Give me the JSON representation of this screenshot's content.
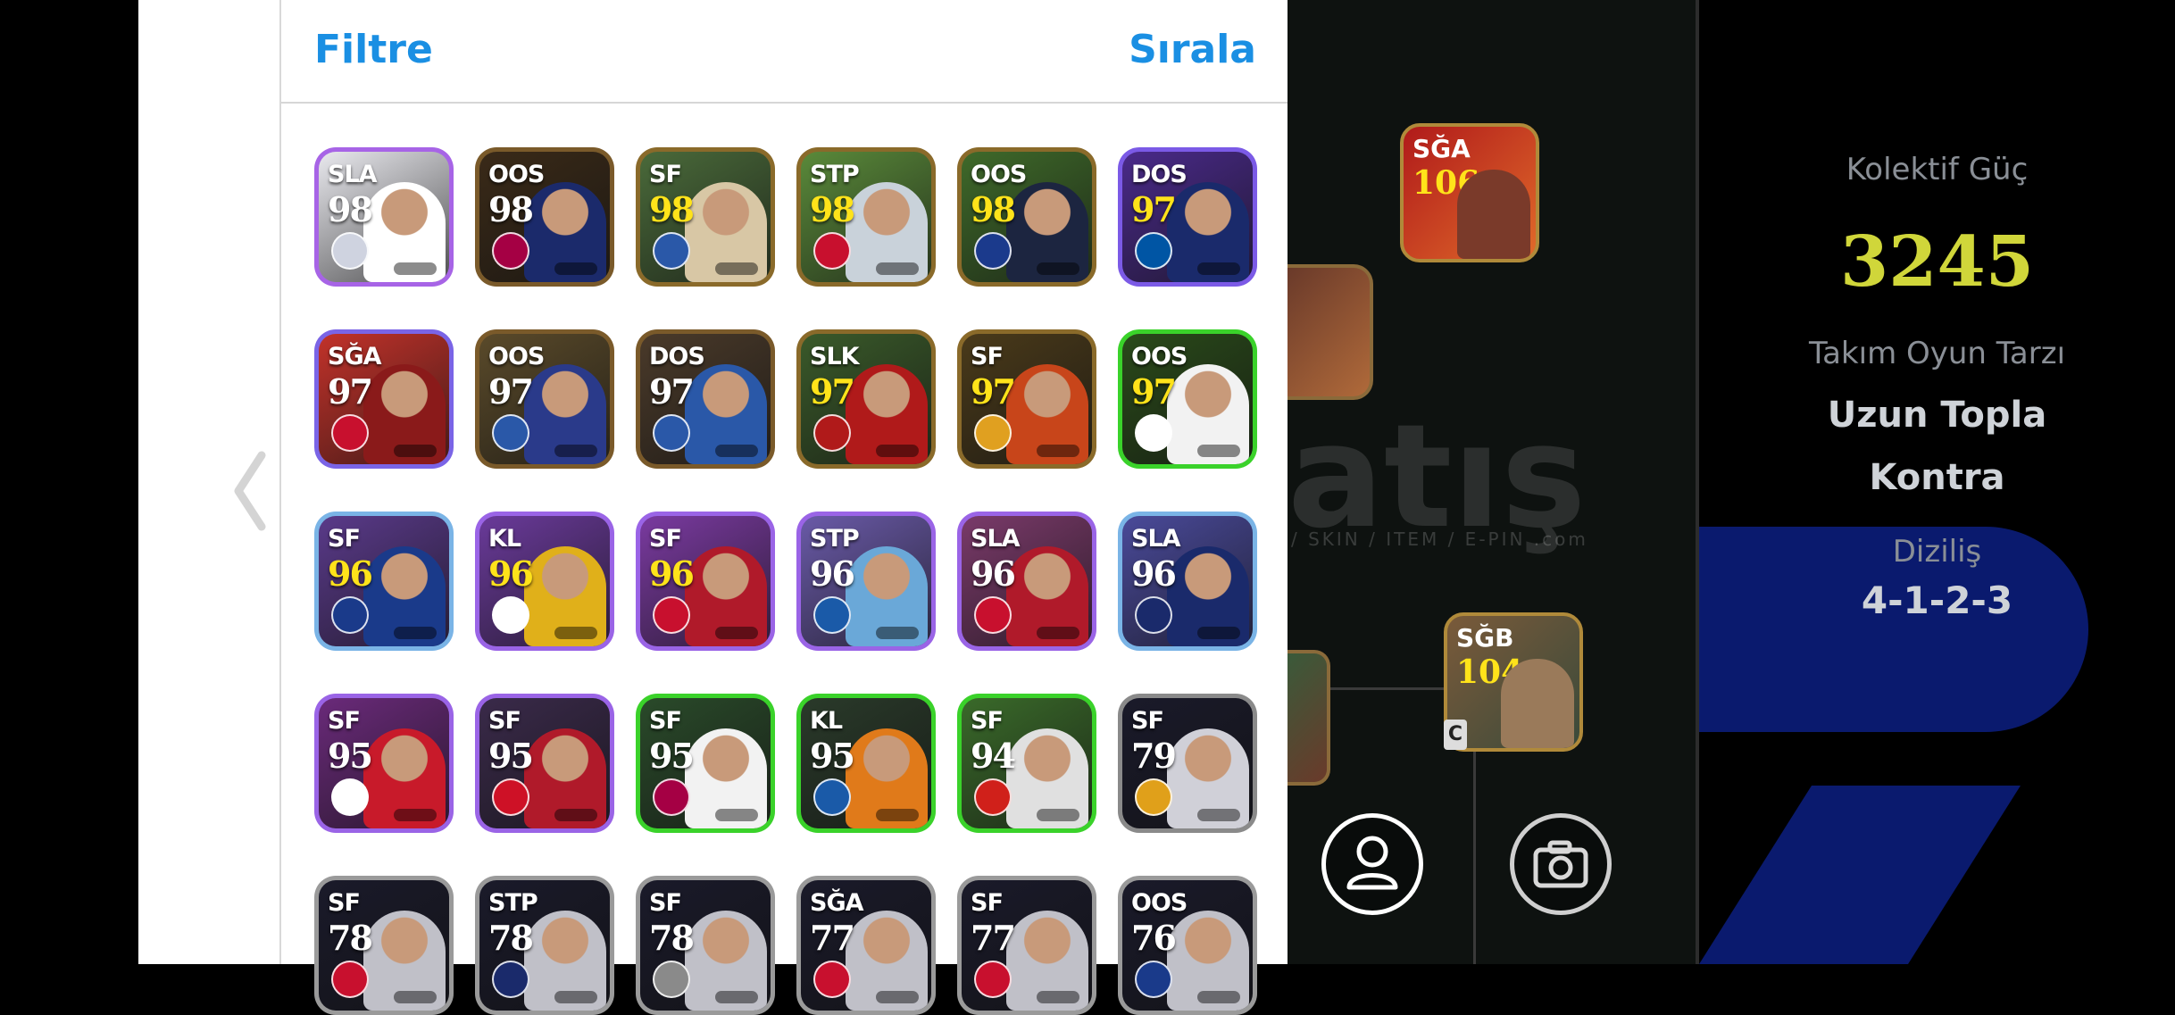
{
  "header": {
    "filter_label": "Filtre",
    "sort_label": "Sırala"
  },
  "cards": [
    {
      "pos": "SLA",
      "rating": "98",
      "gold": false,
      "border": "#a764e6",
      "bg": "#e9e9ee",
      "accent": "#ffffff",
      "badge": "#cfd3e0"
    },
    {
      "pos": "OOS",
      "rating": "98",
      "gold": false,
      "border": "#7a5a2a",
      "bg": "#3a2a18",
      "accent": "#1b2a6b",
      "badge": "#a50044"
    },
    {
      "pos": "SF",
      "rating": "98",
      "gold": true,
      "border": "#8a6a2a",
      "bg": "#4a6a3a",
      "accent": "#d8c7a5",
      "badge": "#2a58a8"
    },
    {
      "pos": "STP",
      "rating": "98",
      "gold": true,
      "border": "#8a6a2a",
      "bg": "#5a8a3a",
      "accent": "#c9d2da",
      "badge": "#c8102e"
    },
    {
      "pos": "OOS",
      "rating": "98",
      "gold": true,
      "border": "#8a6a2a",
      "bg": "#3f6a2a",
      "accent": "#1c2540",
      "badge": "#1b3a8c"
    },
    {
      "pos": "DOS",
      "rating": "97",
      "gold": true,
      "border": "#7b5ae6",
      "bg": "#4a2a8a",
      "accent": "#1a2a6b",
      "badge": "#0055a4"
    },
    {
      "pos": "SĞA",
      "rating": "97",
      "gold": false,
      "border": "#7a64e6",
      "bg": "#c2322a",
      "accent": "#8a1a1a",
      "badge": "#c8102e"
    },
    {
      "pos": "OOS",
      "rating": "97",
      "gold": false,
      "border": "#7a5a2a",
      "bg": "#5a4a2a",
      "accent": "#2a3a8a",
      "badge": "#2a58a8"
    },
    {
      "pos": "DOS",
      "rating": "97",
      "gold": false,
      "border": "#7a5a2a",
      "bg": "#4a3a2a",
      "accent": "#2a58a8",
      "badge": "#2a58a8"
    },
    {
      "pos": "SLK",
      "rating": "97",
      "gold": true,
      "border": "#8a6a2a",
      "bg": "#3a5a2a",
      "accent": "#b01a1a",
      "badge": "#b01a1a"
    },
    {
      "pos": "SF",
      "rating": "97",
      "gold": true,
      "border": "#8a6a2a",
      "bg": "#4a3a1a",
      "accent": "#c8451a",
      "badge": "#e0a020"
    },
    {
      "pos": "OOS",
      "rating": "97",
      "gold": true,
      "border": "#3ad22a",
      "bg": "#2a4a1a",
      "accent": "#f2f2f2",
      "badge": "#ffffff"
    },
    {
      "pos": "SF",
      "rating": "96",
      "gold": true,
      "border": "#7ab4e6",
      "bg": "#5a3a8a",
      "accent": "#1a3a8a",
      "badge": "#1a3a8a"
    },
    {
      "pos": "KL",
      "rating": "96",
      "gold": true,
      "border": "#9a64e6",
      "bg": "#6a3a9a",
      "accent": "#e0b01a",
      "badge": "#ffffff"
    },
    {
      "pos": "SF",
      "rating": "96",
      "gold": true,
      "border": "#9a64e6",
      "bg": "#7a3aa0",
      "accent": "#b01a2a",
      "badge": "#c8102e"
    },
    {
      "pos": "STP",
      "rating": "96",
      "gold": false,
      "border": "#9a64e6",
      "bg": "#6a5aa8",
      "accent": "#6aa8d8",
      "badge": "#1a5aa8"
    },
    {
      "pos": "SLA",
      "rating": "96",
      "gold": false,
      "border": "#9a64e6",
      "bg": "#7a3a6a",
      "accent": "#b01a2a",
      "badge": "#c8102e"
    },
    {
      "pos": "SLA",
      "rating": "96",
      "gold": false,
      "border": "#7ab4e6",
      "bg": "#4a4a9a",
      "accent": "#1a2a6b",
      "badge": "#1a2a6b"
    },
    {
      "pos": "SF",
      "rating": "95",
      "gold": false,
      "border": "#9a64e6",
      "bg": "#6a2a7a",
      "accent": "#c81a2a",
      "badge": "#ffffff"
    },
    {
      "pos": "SF",
      "rating": "95",
      "gold": false,
      "border": "#9a64e6",
      "bg": "#3a2a4a",
      "accent": "#b01a2a",
      "badge": "#ce1126"
    },
    {
      "pos": "SF",
      "rating": "95",
      "gold": false,
      "border": "#3ad22a",
      "bg": "#2a4a2a",
      "accent": "#f2f2f2",
      "badge": "#a50044"
    },
    {
      "pos": "KL",
      "rating": "95",
      "gold": false,
      "border": "#3ad22a",
      "bg": "#2a3a2a",
      "accent": "#e07a1a",
      "badge": "#1a5aa8"
    },
    {
      "pos": "SF",
      "rating": "94",
      "gold": false,
      "border": "#3ad22a",
      "bg": "#3a6a2a",
      "accent": "#e0e0e0",
      "badge": "#d0201a"
    },
    {
      "pos": "SF",
      "rating": "79",
      "gold": false,
      "border": "#8a8a8a",
      "bg": "#1a1a2a",
      "accent": "#d0d0d8",
      "badge": "#e0a01a"
    },
    {
      "pos": "SF",
      "rating": "78",
      "gold": false,
      "border": "#9a9a9a",
      "bg": "#1a1a2a",
      "accent": "#c0c0c8",
      "badge": "#c8102e"
    },
    {
      "pos": "STP",
      "rating": "78",
      "gold": false,
      "border": "#9a9a9a",
      "bg": "#1a1a2a",
      "accent": "#c0c0c8",
      "badge": "#1a2a6b"
    },
    {
      "pos": "SF",
      "rating": "78",
      "gold": false,
      "border": "#9a9a9a",
      "bg": "#1a1a2a",
      "accent": "#c0c0c8",
      "badge": "#8a8a8a"
    },
    {
      "pos": "SĞA",
      "rating": "77",
      "gold": false,
      "border": "#9a9a9a",
      "bg": "#1a1a2a",
      "accent": "#c0c0c8",
      "badge": "#c8102e"
    },
    {
      "pos": "SF",
      "rating": "77",
      "gold": false,
      "border": "#9a9a9a",
      "bg": "#1a1a2a",
      "accent": "#c0c0c8",
      "badge": "#c8102e"
    },
    {
      "pos": "OOS",
      "rating": "76",
      "gold": false,
      "border": "#9a9a9a",
      "bg": "#1a1a2a",
      "accent": "#c0c0c8",
      "badge": "#1a3a8a"
    }
  ],
  "pitch": {
    "watermark": "atış",
    "watermark_sub": "/ SKIN / ITEM / E-PIN     .com",
    "cards": [
      {
        "pos": "SĞA",
        "rating": "106"
      },
      {
        "pos": "SĞB",
        "rating": "104"
      }
    ],
    "captain_mark": "C"
  },
  "team": {
    "power_label": "Kolektif Güç",
    "power_value": "3245",
    "style_label": "Takım Oyun Tarzı",
    "style_value_1": "Uzun Topla",
    "style_value_2": "Kontra",
    "formation_label": "Diziliş",
    "formation_value": "4-1-2-3"
  },
  "colors": {
    "link_blue": "#1a8fe3",
    "power_yellow": "#d0d63a",
    "panel_blue": "#0a1a6e"
  }
}
